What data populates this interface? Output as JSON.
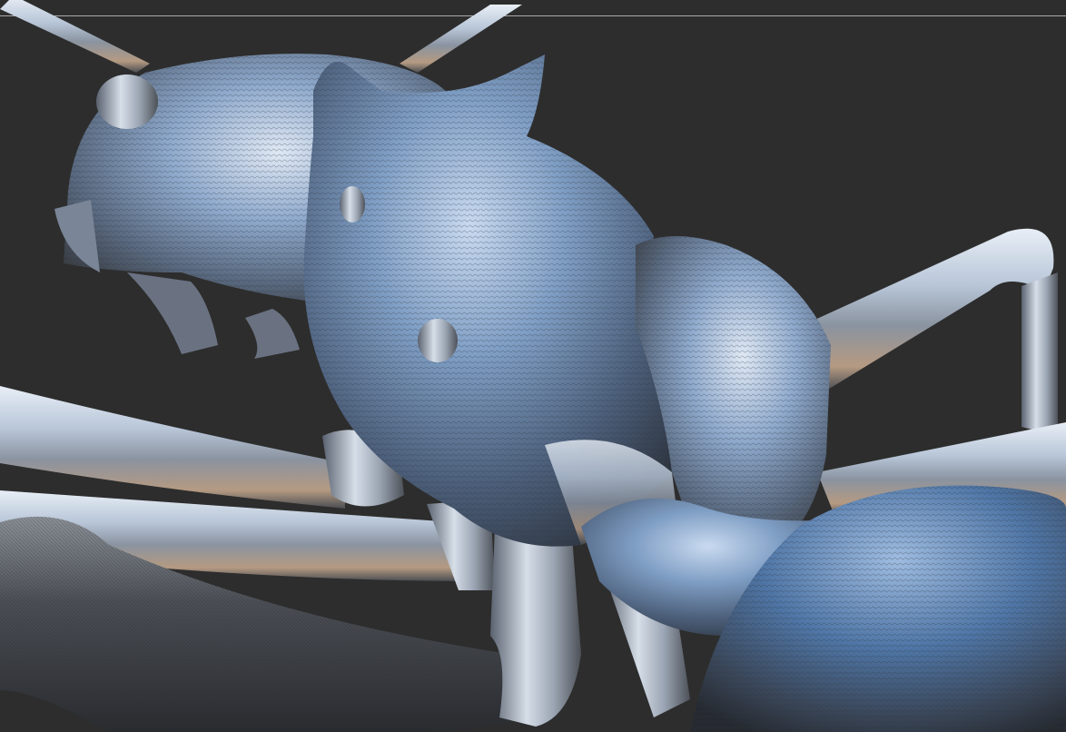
{
  "app": {
    "title": ""
  },
  "canvas": {
    "background_color": "#2d2d2d",
    "rule_color": "#a9a9a9",
    "model": "ant-sculpt",
    "material": "metallic-blue-chrome",
    "colors": {
      "highlight": "#e6ecf4",
      "mid": "#8c9fb8",
      "shadow": "#3a3f48",
      "warm": "#b59a82"
    }
  }
}
